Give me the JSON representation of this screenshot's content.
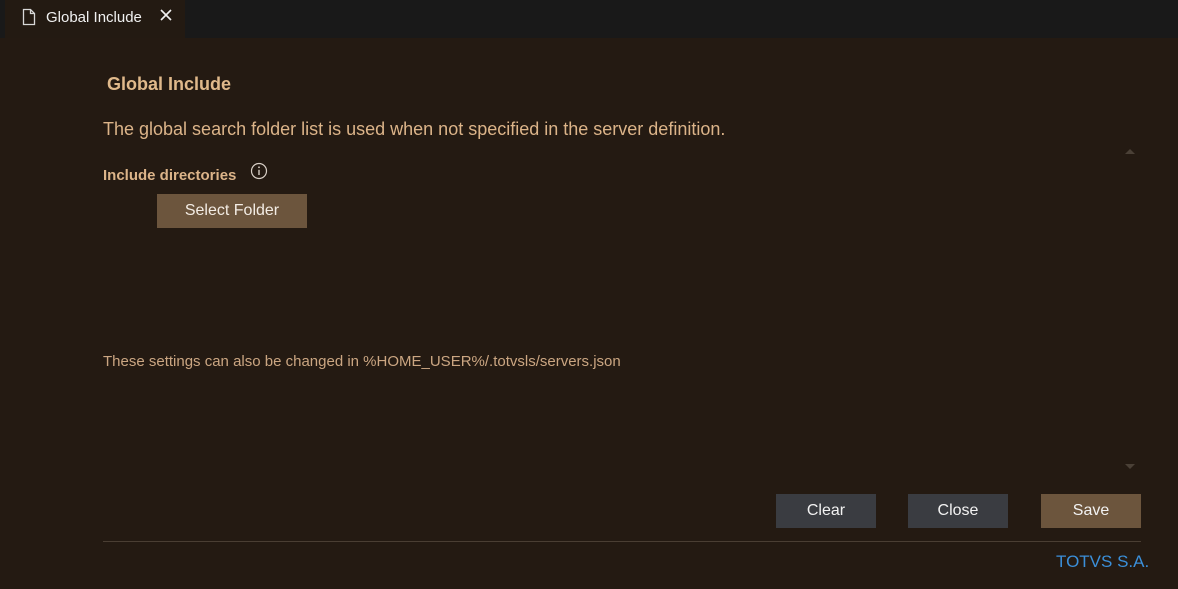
{
  "tab": {
    "label": "Global Include",
    "icon": "file-icon",
    "close_icon": "close-icon"
  },
  "form": {
    "title": "Global Include",
    "description": "The global search folder list is used when not specified in the server definition.",
    "include_label": "Include directories",
    "info_icon": "info-icon",
    "select_folder_label": "Select Folder",
    "note": "These settings can also be changed in %HOME_USER%/.totvsls/servers.json"
  },
  "actions": {
    "clear_label": "Clear",
    "close_label": "Close",
    "save_label": "Save"
  },
  "footer": {
    "company": "TOTVS S.A."
  },
  "colors": {
    "background": "#241a12",
    "heading": "#e0b98b",
    "primary_button": "#6c553d",
    "secondary_button": "#3a3c41",
    "link": "#3b8fd9"
  }
}
